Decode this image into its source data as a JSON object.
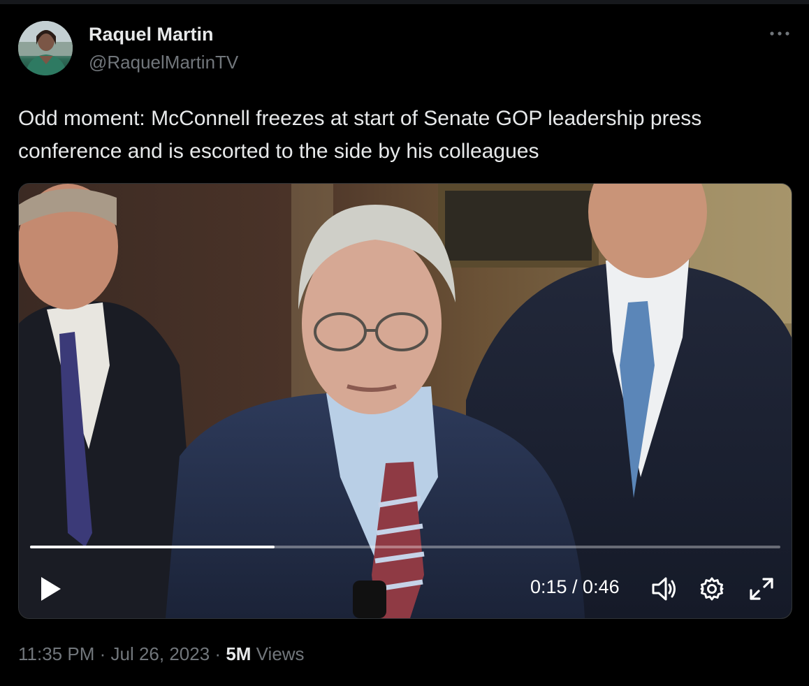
{
  "author": {
    "name": "Raquel Martin",
    "handle": "@RaquelMartinTV"
  },
  "more_icon": "more-horizontal-icon",
  "tweet_text": "Odd moment: McConnell freezes at start of Senate GOP leadership press conference and is escorted to the side by his colleagues",
  "video": {
    "progress_fraction": 0.326,
    "timecode": "0:15 / 0:46",
    "controls": [
      "play-icon",
      "volume-icon",
      "settings-gear-icon",
      "fullscreen-icon"
    ]
  },
  "meta": {
    "time": "11:35 PM",
    "separator": "·",
    "date": "Jul 26, 2023",
    "views_count": "5M",
    "views_label": "Views"
  },
  "colors": {
    "background": "#000000",
    "primary_text": "#e7e9ea",
    "secondary_text": "#71767b",
    "border": "#2f3336"
  }
}
